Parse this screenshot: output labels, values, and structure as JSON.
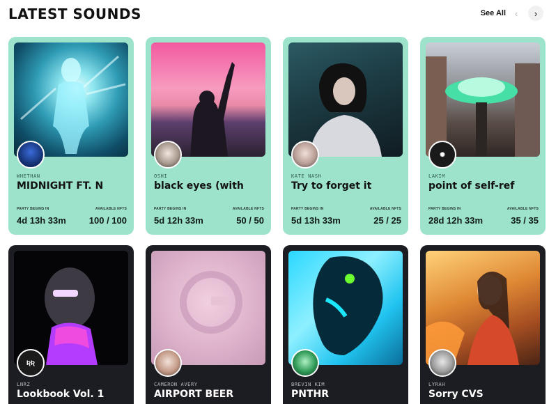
{
  "header": {
    "title": "LATEST SOUNDS",
    "see_all": "See All",
    "prev_icon": "‹",
    "next_icon": "›"
  },
  "labels": {
    "party_begins": "PARTY BEGINS IN",
    "available_nfts": "AVAILABLE NFTS"
  },
  "cards": [
    {
      "artist": "WHETHAN",
      "title": "MIDNIGHT FT. N",
      "countdown": "4d 13h 33m",
      "available": "100 / 100",
      "theme": "mint",
      "art_icon": "glowing-figure-art",
      "avatar_icon": "artist-photo-icon"
    },
    {
      "artist": "OSHI",
      "title": "black eyes (with",
      "countdown": "5d 12h 33m",
      "available": "50 / 50",
      "theme": "mint",
      "art_icon": "sunset-silhouette-art",
      "avatar_icon": "artist-photo-icon"
    },
    {
      "artist": "KATE NASH",
      "title": "Try to forget it",
      "countdown": "5d 13h 33m",
      "available": "25 / 25",
      "theme": "mint",
      "art_icon": "portrait-art",
      "avatar_icon": "artist-photo-icon"
    },
    {
      "artist": "LAKIM",
      "title": "point of self-ref",
      "countdown": "28d 12h 33m",
      "available": "35 / 35",
      "theme": "mint",
      "art_icon": "ufo-street-art",
      "avatar_icon": "artist-logo-icon"
    },
    {
      "artist": "LNRZ",
      "title": "Lookbook Vol. 1",
      "theme": "dark",
      "art_icon": "masked-figure-art",
      "avatar_icon": "artist-logo-icon"
    },
    {
      "artist": "CAMERON AVERY",
      "title": "AIRPORT BEER",
      "theme": "dark",
      "art_icon": "pink-texture-art",
      "avatar_icon": "artist-photo-icon"
    },
    {
      "artist": "BREVIN KIM",
      "title": "PNTHR",
      "theme": "dark",
      "art_icon": "neon-face-art",
      "avatar_icon": "artist-photo-icon"
    },
    {
      "artist": "LYRAH",
      "title": "Sorry CVS",
      "theme": "dark",
      "art_icon": "autumn-portrait-art",
      "avatar_icon": "artist-photo-icon"
    }
  ],
  "colors": {
    "mint_card": "#9de3cc",
    "dark_card": "#1c1d22"
  }
}
